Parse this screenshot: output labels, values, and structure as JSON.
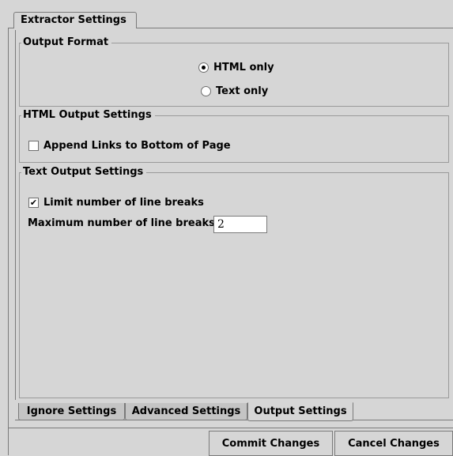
{
  "top_tab": {
    "label": "Extractor Settings"
  },
  "output_format": {
    "title": "Output Format",
    "options": [
      {
        "label": "HTML only",
        "selected": true
      },
      {
        "label": "Text only",
        "selected": false
      }
    ]
  },
  "html_settings": {
    "title": "HTML Output Settings",
    "append_links_label": "Append Links to Bottom of Page",
    "append_links_checked": false
  },
  "text_settings": {
    "title": "Text Output Settings",
    "limit_label": "Limit number of line breaks",
    "limit_checked": true,
    "max_label": "Maximum number of line breaks",
    "max_value": "2"
  },
  "bottom_tabs": [
    {
      "label": "Ignore Settings",
      "active": false
    },
    {
      "label": "Advanced Settings",
      "active": false
    },
    {
      "label": "Output Settings",
      "active": true
    }
  ],
  "buttons": {
    "commit": "Commit Changes",
    "cancel": "Cancel Changes"
  }
}
